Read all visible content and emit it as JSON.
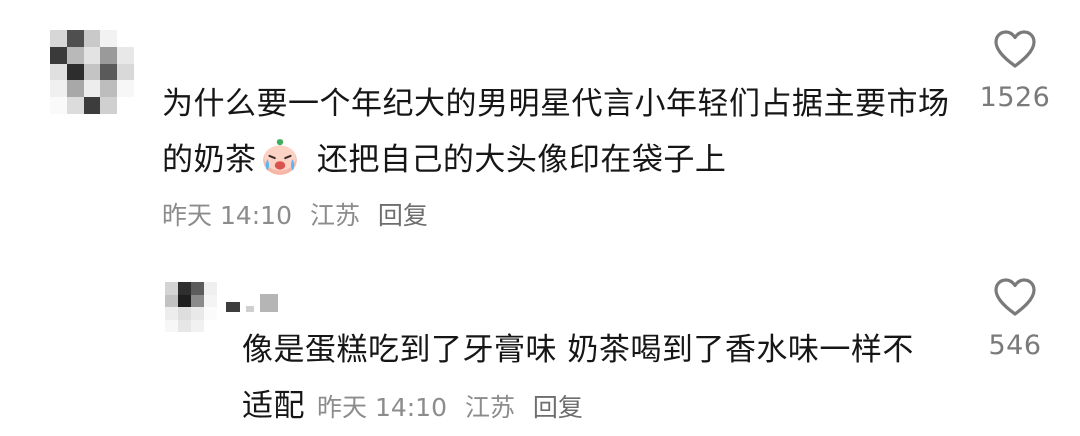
{
  "colors": {
    "text": "#161616",
    "meta": "#8c8c8c",
    "icon": "#7a7a7a"
  },
  "comments": [
    {
      "text_before_emoji": "为什么要一个年纪大的男明星代言小年轻们占据主要市场的奶茶",
      "emoji": "crying-face-emoji",
      "text_after_emoji": " 还把自己的大头像印在袋子上",
      "time": "昨天 14:10",
      "location": "江苏",
      "reply_label": "回复",
      "like_icon": "heart-outline-icon",
      "likes": "1526"
    },
    {
      "text": "像是蛋糕吃到了牙膏味 奶茶喝到了香水味一样不适配",
      "time": "昨天 14:10",
      "location": "江苏",
      "reply_label": "回复",
      "like_icon": "heart-outline-icon",
      "likes": "546"
    }
  ]
}
